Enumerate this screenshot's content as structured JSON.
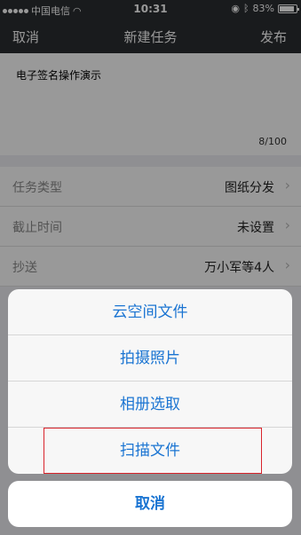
{
  "status": {
    "carrier": "中国电信",
    "time": "10:31",
    "battery": "83%"
  },
  "nav": {
    "cancel": "取消",
    "title": "新建任务",
    "publish": "发布"
  },
  "task": {
    "text": "电子签名操作演示",
    "count": "8/100"
  },
  "form": {
    "rows": [
      {
        "label": "任务类型",
        "value": "图纸分发"
      },
      {
        "label": "截止时间",
        "value": "未设置"
      },
      {
        "label": "抄送",
        "value": "万小军等4人"
      }
    ]
  },
  "sheet": {
    "items": [
      "云空间文件",
      "拍摄照片",
      "相册选取",
      "扫描文件"
    ],
    "cancel": "取消"
  }
}
